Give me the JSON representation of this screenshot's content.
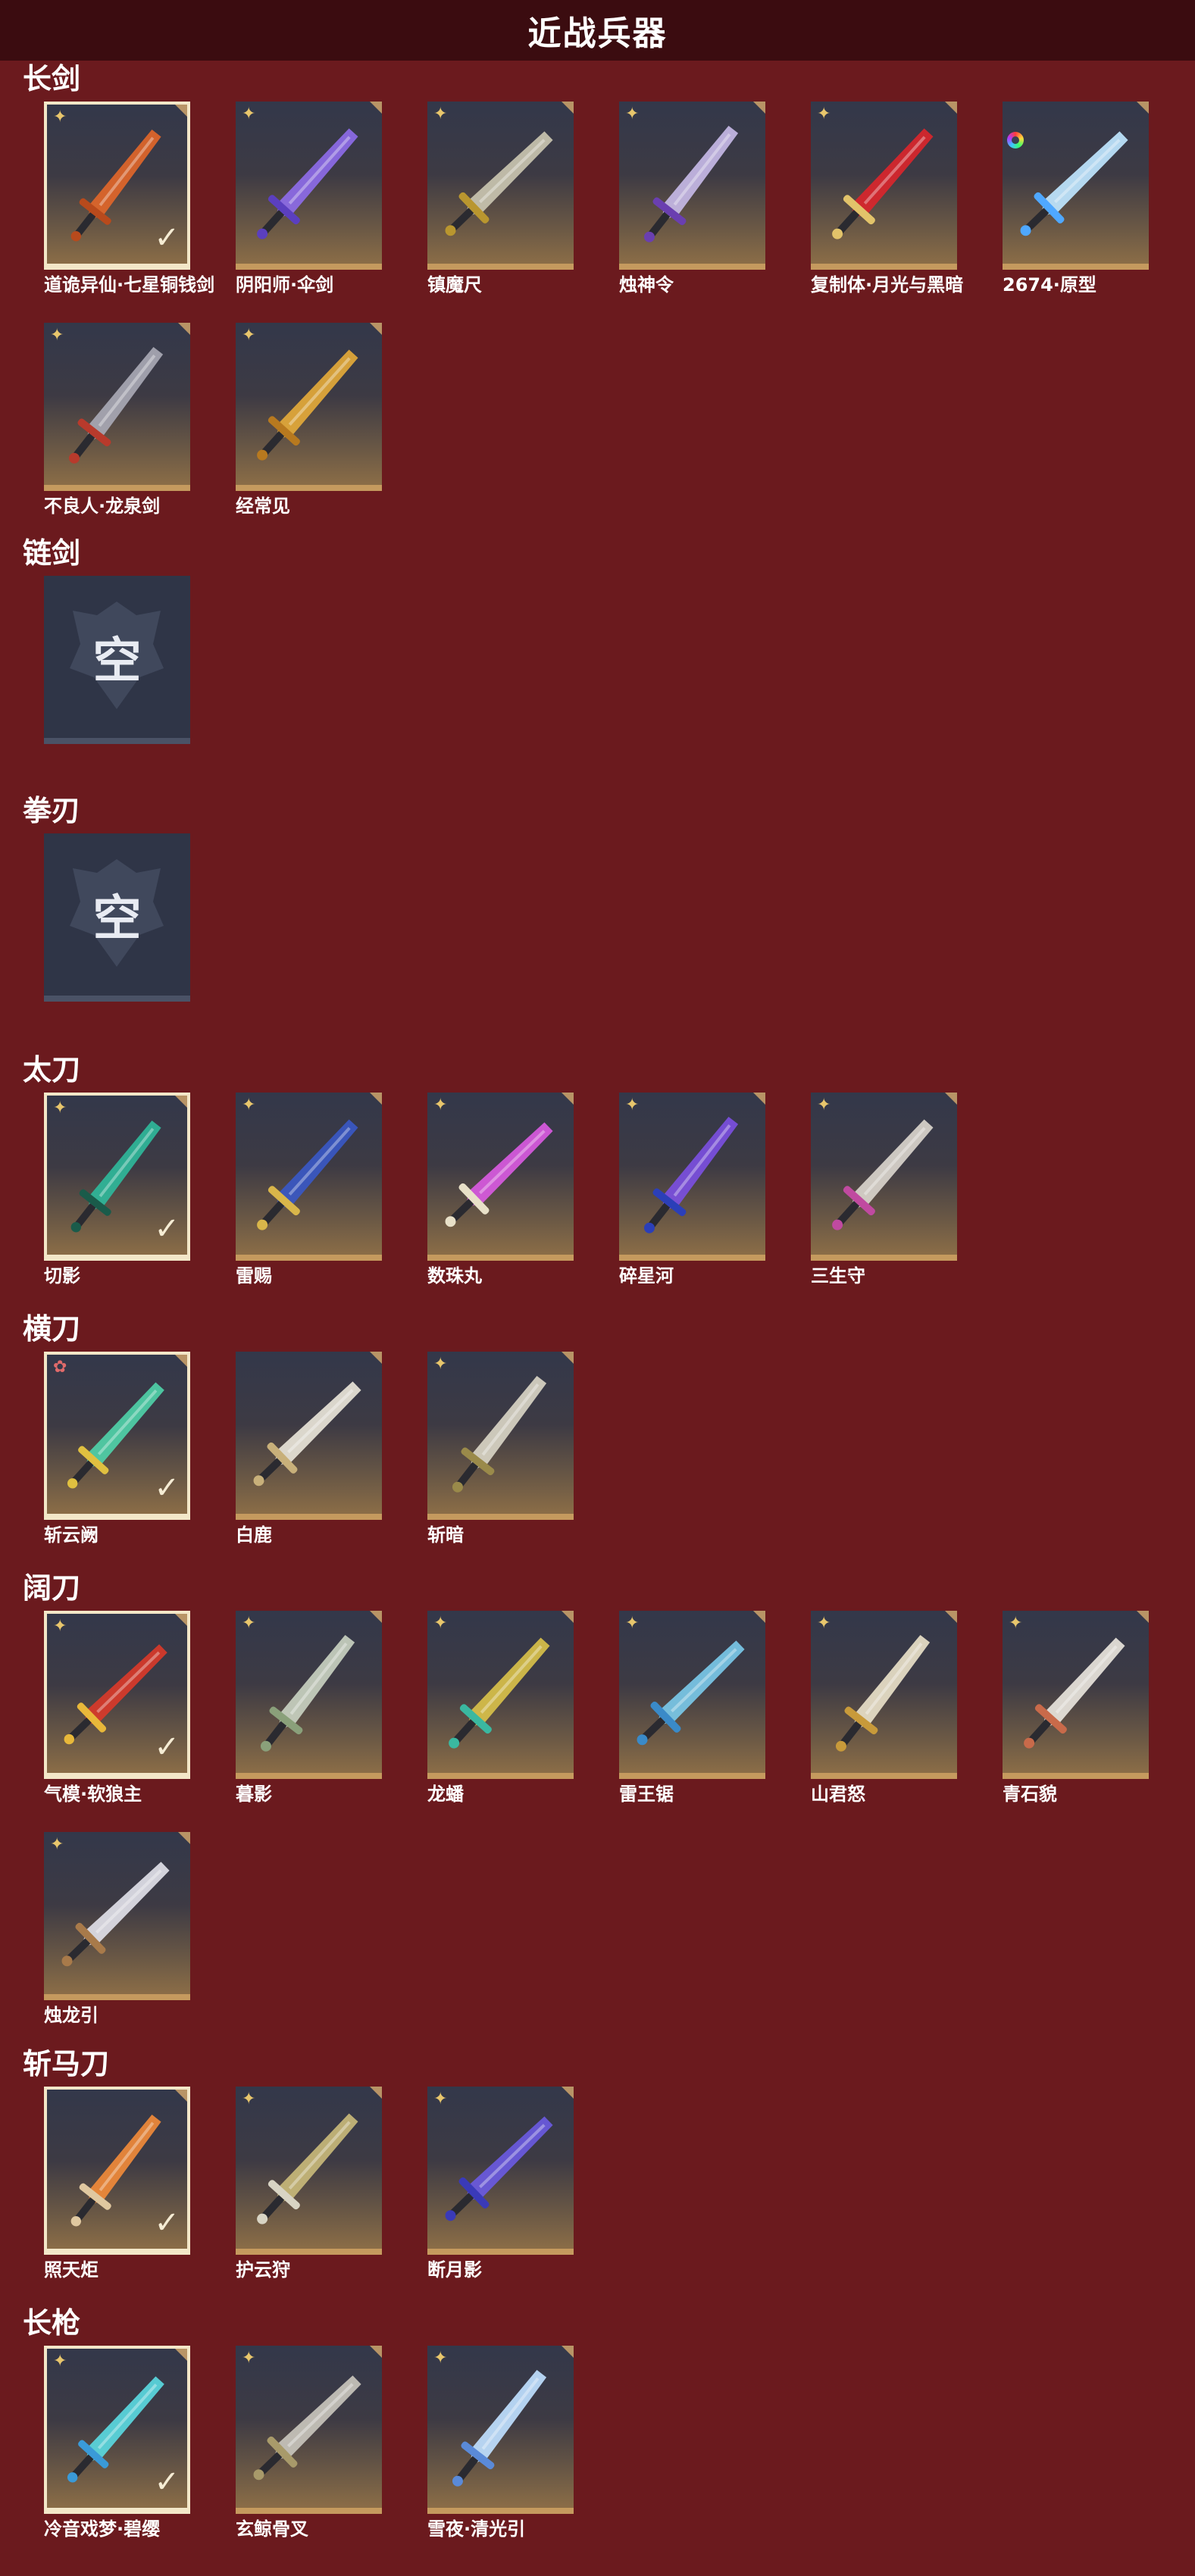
{
  "header": {
    "title": "近战兵器"
  },
  "empty_label": "空",
  "sections": [
    {
      "title": "长剑",
      "items": [
        {
          "name": "道诡异仙·七星铜钱剑",
          "rarity": "gold",
          "equipped": true,
          "colors": [
            "#e0662a",
            "#b84a1c"
          ]
        },
        {
          "name": "阴阳师·伞剑",
          "rarity": "gold",
          "equipped": false,
          "colors": [
            "#8d6be8",
            "#5b3fbf"
          ]
        },
        {
          "name": "镇魔尺",
          "rarity": "gold",
          "equipped": false,
          "colors": [
            "#c9c4b0",
            "#b9962f"
          ]
        },
        {
          "name": "烛神令",
          "rarity": "gold",
          "equipped": false,
          "colors": [
            "#c6b8e6",
            "#6a3fb0"
          ]
        },
        {
          "name": "复制体·月光与黑暗",
          "rarity": "gold",
          "equipped": false,
          "colors": [
            "#d9262c",
            "#e2c36a"
          ]
        },
        {
          "name": "2674·原型",
          "rarity": "rainbow",
          "equipped": false,
          "colors": [
            "#bfe6ff",
            "#4fa8ff"
          ]
        },
        {
          "name": "不良人·龙泉剑",
          "rarity": "gold",
          "equipped": false,
          "colors": [
            "#a8a8b4",
            "#b83a2c"
          ]
        },
        {
          "name": "经常见",
          "rarity": "gold",
          "equipped": false,
          "colors": [
            "#e3a93a",
            "#b7791f"
          ]
        }
      ]
    },
    {
      "title": "链剑",
      "items": []
    },
    {
      "title": "拳刃",
      "items": []
    },
    {
      "title": "太刀",
      "items": [
        {
          "name": "切影",
          "rarity": "gold",
          "equipped": true,
          "colors": [
            "#2fb79a",
            "#1a5b4a"
          ]
        },
        {
          "name": "雷赐",
          "rarity": "gold",
          "equipped": false,
          "colors": [
            "#3a58c4",
            "#d9b64a"
          ]
        },
        {
          "name": "数珠丸",
          "rarity": "gold",
          "equipped": false,
          "colors": [
            "#d85ae0",
            "#e8e0c8"
          ]
        },
        {
          "name": "碎星河",
          "rarity": "gold",
          "equipped": false,
          "colors": [
            "#7b4fe0",
            "#2b3fb8"
          ]
        },
        {
          "name": "三生守",
          "rarity": "gold",
          "equipped": false,
          "colors": [
            "#d9d4cc",
            "#c04aa0"
          ]
        }
      ]
    },
    {
      "title": "横刀",
      "items": [
        {
          "name": "斩云阙",
          "rarity": "red",
          "equipped": true,
          "colors": [
            "#4fd0a8",
            "#e0c040"
          ]
        },
        {
          "name": "白鹿",
          "rarity": "none",
          "equipped": false,
          "colors": [
            "#e8e4d8",
            "#c8b07a"
          ]
        },
        {
          "name": "斩暗",
          "rarity": "gold",
          "equipped": false,
          "colors": [
            "#d8d4c4",
            "#9a8a4a"
          ]
        }
      ]
    },
    {
      "title": "阔刀",
      "items": [
        {
          "name": "气模·软狼主",
          "rarity": "gold",
          "equipped": true,
          "colors": [
            "#d83a2a",
            "#e8b83a"
          ]
        },
        {
          "name": "暮影",
          "rarity": "gold",
          "equipped": false,
          "colors": [
            "#c8d0c0",
            "#8aa07a"
          ]
        },
        {
          "name": "龙蟠",
          "rarity": "gold",
          "equipped": false,
          "colors": [
            "#d8c04a",
            "#3ab8a0"
          ]
        },
        {
          "name": "雷王锯",
          "rarity": "gold",
          "equipped": false,
          "colors": [
            "#7ac8e8",
            "#3a8ac8"
          ]
        },
        {
          "name": "山君怒",
          "rarity": "gold",
          "equipped": false,
          "colors": [
            "#e8e0c8",
            "#c89a3a"
          ]
        },
        {
          "name": "青石貌",
          "rarity": "gold",
          "equipped": false,
          "colors": [
            "#e8e4dc",
            "#c86a4a"
          ]
        },
        {
          "name": "烛龙引",
          "rarity": "gold",
          "equipped": false,
          "colors": [
            "#e0e0e8",
            "#a87a4a"
          ]
        }
      ]
    },
    {
      "title": "斩马刀",
      "items": [
        {
          "name": "照天炬",
          "rarity": "none",
          "equipped": true,
          "colors": [
            "#f08a3a",
            "#e0c8a0"
          ]
        },
        {
          "name": "护云狩",
          "rarity": "gold",
          "equipped": false,
          "colors": [
            "#c8b87a",
            "#d8d4c4"
          ]
        },
        {
          "name": "断月影",
          "rarity": "gold",
          "equipped": false,
          "colors": [
            "#6a5ae0",
            "#3a3ab8"
          ]
        }
      ]
    },
    {
      "title": "长枪",
      "items": [
        {
          "name": "冷音戏梦·碧缨",
          "rarity": "gold",
          "equipped": true,
          "colors": [
            "#5ad8e0",
            "#3a9ad8"
          ]
        },
        {
          "name": "玄鲸骨叉",
          "rarity": "gold",
          "equipped": false,
          "colors": [
            "#c8c4bc",
            "#a89a6a"
          ]
        },
        {
          "name": "雪夜·清光引",
          "rarity": "gold",
          "equipped": false,
          "colors": [
            "#bfe0ff",
            "#5a8ad8"
          ]
        }
      ]
    }
  ]
}
